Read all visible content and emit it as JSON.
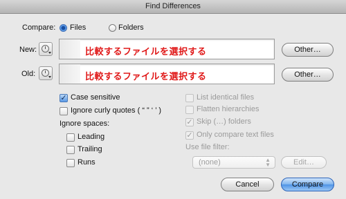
{
  "window": {
    "title": "Find Differences"
  },
  "compare": {
    "label": "Compare:",
    "options": [
      {
        "label": "Files",
        "selected": true
      },
      {
        "label": "Folders",
        "selected": false
      }
    ]
  },
  "new": {
    "label": "New:",
    "hint": "比較するファイルを選択する",
    "other_label": "Other…"
  },
  "old": {
    "label": "Old:",
    "hint": "比較するファイルを選択する",
    "other_label": "Other…"
  },
  "left_options": {
    "case_sensitive": {
      "label": "Case sensitive",
      "checked": true
    },
    "ignore_curly": {
      "label": "Ignore curly quotes ( “ ” ‘ ’ )",
      "checked": false
    },
    "ignore_spaces_label": "Ignore spaces:",
    "spaces": [
      {
        "label": "Leading",
        "checked": false
      },
      {
        "label": "Trailing",
        "checked": false
      },
      {
        "label": "Runs",
        "checked": false
      }
    ]
  },
  "right_options": {
    "list_identical": {
      "label": "List identical files",
      "checked": false
    },
    "flatten": {
      "label": "Flatten hierarchies",
      "checked": false
    },
    "skip_folders": {
      "label": "Skip (…) folders",
      "checked": true
    },
    "only_text": {
      "label": "Only compare text files",
      "checked": true
    },
    "filter_label": "Use file filter:",
    "filter_value": "(none)",
    "edit_label": "Edit…"
  },
  "buttons": {
    "cancel": "Cancel",
    "compare": "Compare"
  },
  "colors": {
    "hint": "#e01818",
    "default_button": "#4e93e6",
    "disabled_text": "#9a9a9a"
  }
}
